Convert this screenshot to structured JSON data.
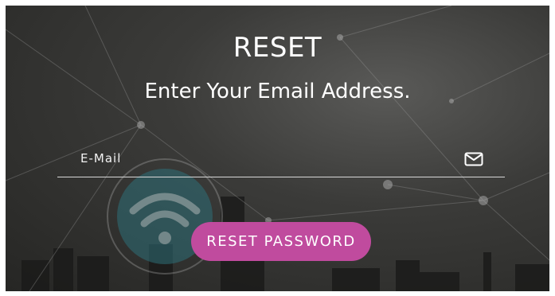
{
  "form": {
    "title": "RESET",
    "subtitle": "Enter Your Email Address.",
    "email_placeholder": "E-Mail",
    "email_value": "",
    "email_icon": "envelope-icon",
    "submit_label": "RESET PASSWORD"
  },
  "colors": {
    "button": "#c04b9e",
    "text": "#ffffff",
    "background": "#2e2e2c"
  }
}
